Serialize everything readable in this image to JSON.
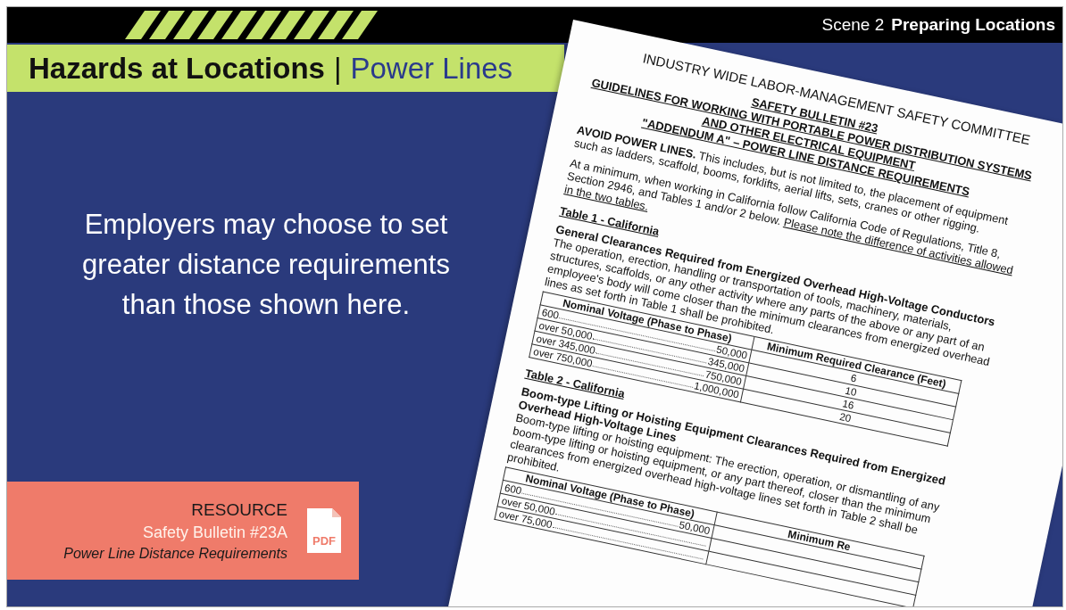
{
  "header": {
    "scene_label": "Scene 2",
    "scene_title": "Preparing Locations"
  },
  "title": {
    "main": "Hazards at Locations",
    "separator": "|",
    "sub": "Power Lines"
  },
  "message": "Employers may choose to set greater distance requirements than those shown here.",
  "resource": {
    "label": "RESOURCE",
    "link": "Safety Bulletin #23A",
    "subtitle": "Power Line Distance Requirements",
    "icon_text": "PDF"
  },
  "document": {
    "blocks": [
      {
        "kind": "title",
        "text": "INDUSTRY WIDE LABOR-MANAGEMENT SAFETY COMMITTEE"
      },
      {
        "kind": "heading",
        "text": "SAFETY BULLETIN #23"
      },
      {
        "kind": "heading",
        "text": "GUIDELINES FOR WORKING WITH PORTABLE POWER DISTRIBUTION SYSTEMS"
      },
      {
        "kind": "heading",
        "text": "AND OTHER ELECTRICAL EQUIPMENT"
      },
      {
        "kind": "heading",
        "text": "\"ADDENDUM A\" – POWER LINE DISTANCE REQUIREMENTS"
      },
      {
        "kind": "paragraph",
        "text": "**AVOID POWER LINES.**  This includes, but is not limited to, the placement of equipment such as ladders, scaffold, booms, forklifts, aerial lifts, sets, cranes or other rigging."
      },
      {
        "kind": "paragraph",
        "text": "At a minimum, when working in California follow California Code of Regulations, Title 8, Section 2946, and Tables 1 and/or 2 below.",
        "underlined": "Please note the difference of activities allowed in the two tables."
      },
      {
        "kind": "section",
        "text": "Table 1 - California"
      },
      {
        "kind": "subheading",
        "text": "General Clearances Required from Energized Overhead High-Voltage Conductors"
      },
      {
        "kind": "body",
        "text": "The operation, erection, handling or transportation of tools, machinery, materials, structures, scaffolds, or any other activity where any parts of the above or any part of an employee's body will come closer than the minimum clearances from energized overhead lines as set forth in Table 1 shall be prohibited."
      },
      {
        "kind": "table",
        "columns": [
          "Nominal Voltage (Phase to Phase)",
          "Minimum Required Clearance (Feet)"
        ],
        "rows": [
          {
            "from": "600",
            "to": "50,000",
            "clearance": "6"
          },
          {
            "from": "over 50,000",
            "to": "345,000",
            "clearance": "10"
          },
          {
            "from": "over 345,000",
            "to": "750,000",
            "clearance": "16"
          },
          {
            "from": "over 750,000",
            "to": "1,000,000",
            "clearance": "20"
          }
        ]
      },
      {
        "kind": "section",
        "text": "Table 2 - California"
      },
      {
        "kind": "subheading",
        "text": "Boom-type Lifting or Hoisting Equipment Clearances Required from Energized Overhead High-Voltage Lines"
      },
      {
        "kind": "body",
        "text": "Boom-type lifting or hoisting equipment:  The erection, operation, or dismantling of any boom-type lifting or hoisting equipment, or any part thereof, closer than the minimum clearances from energized overhead high-voltage lines set forth in Table 2 shall be prohibited."
      },
      {
        "kind": "table",
        "columns": [
          "Nominal Voltage (Phase to Phase)",
          "Minimum Re"
        ],
        "rows": [
          {
            "from": "600",
            "to": "50,000"
          },
          {
            "from": "over 50,000"
          },
          {
            "from": "over 75,000"
          }
        ]
      }
    ]
  }
}
